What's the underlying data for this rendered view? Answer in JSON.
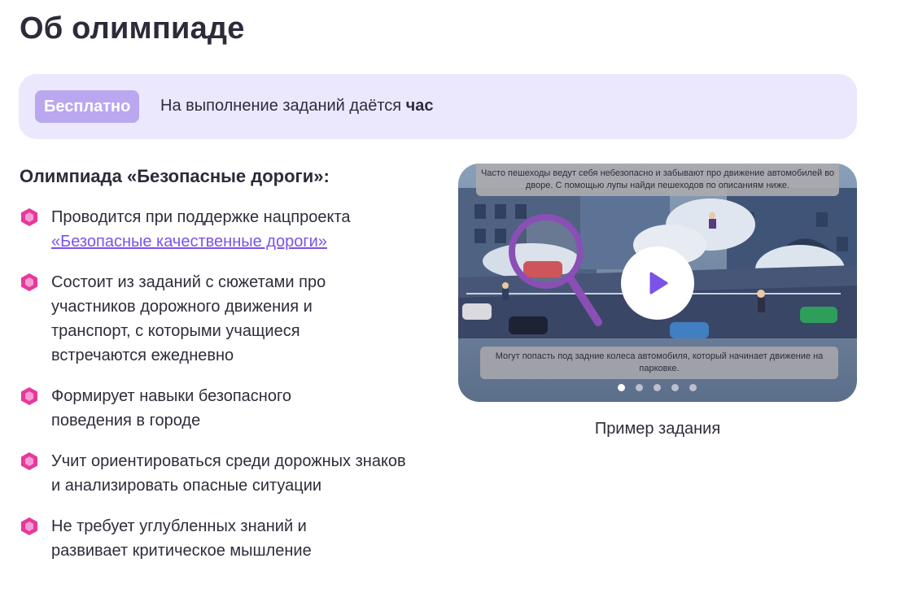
{
  "page": {
    "title": "Об олимпиаде"
  },
  "banner": {
    "badge": "Бесплатно",
    "text_prefix": "На выполнение заданий даётся ",
    "text_bold": "час"
  },
  "about": {
    "title": "Олимпиада «Безопасные дороги»:",
    "items": [
      {
        "text": "Проводится при поддержке нацпроекта",
        "link": "«Безопасные качественные дороги»"
      },
      {
        "text": "Состоит из заданий с сюжетами про участников дорожного движения и транспорт, с которыми учащиеся встречаются ежедневно"
      },
      {
        "text": "Формирует навыки безопасного поведения в городе"
      },
      {
        "text": "Учит ориентироваться среди дорожных знаков и анализировать опасные ситуации"
      },
      {
        "text": "Не требует углубленных знаний и развивает критическое мышление"
      }
    ],
    "bullet_icon": "pink-gem-icon",
    "bullet_color": "#e8389c"
  },
  "media": {
    "top_caption": "Часто пешеходы ведут себя небезопасно и забывают про движение автомобилей во дворе. С помощью лупы найди пешеходов по описаниям ниже.",
    "bottom_caption": "Могут попасть под задние колеса автомобиля, который начинает движение на парковке.",
    "play_icon": "play-icon",
    "accent_color": "#7b52e8",
    "slides_count": 5,
    "active_slide": 1,
    "caption": "Пример задания"
  }
}
